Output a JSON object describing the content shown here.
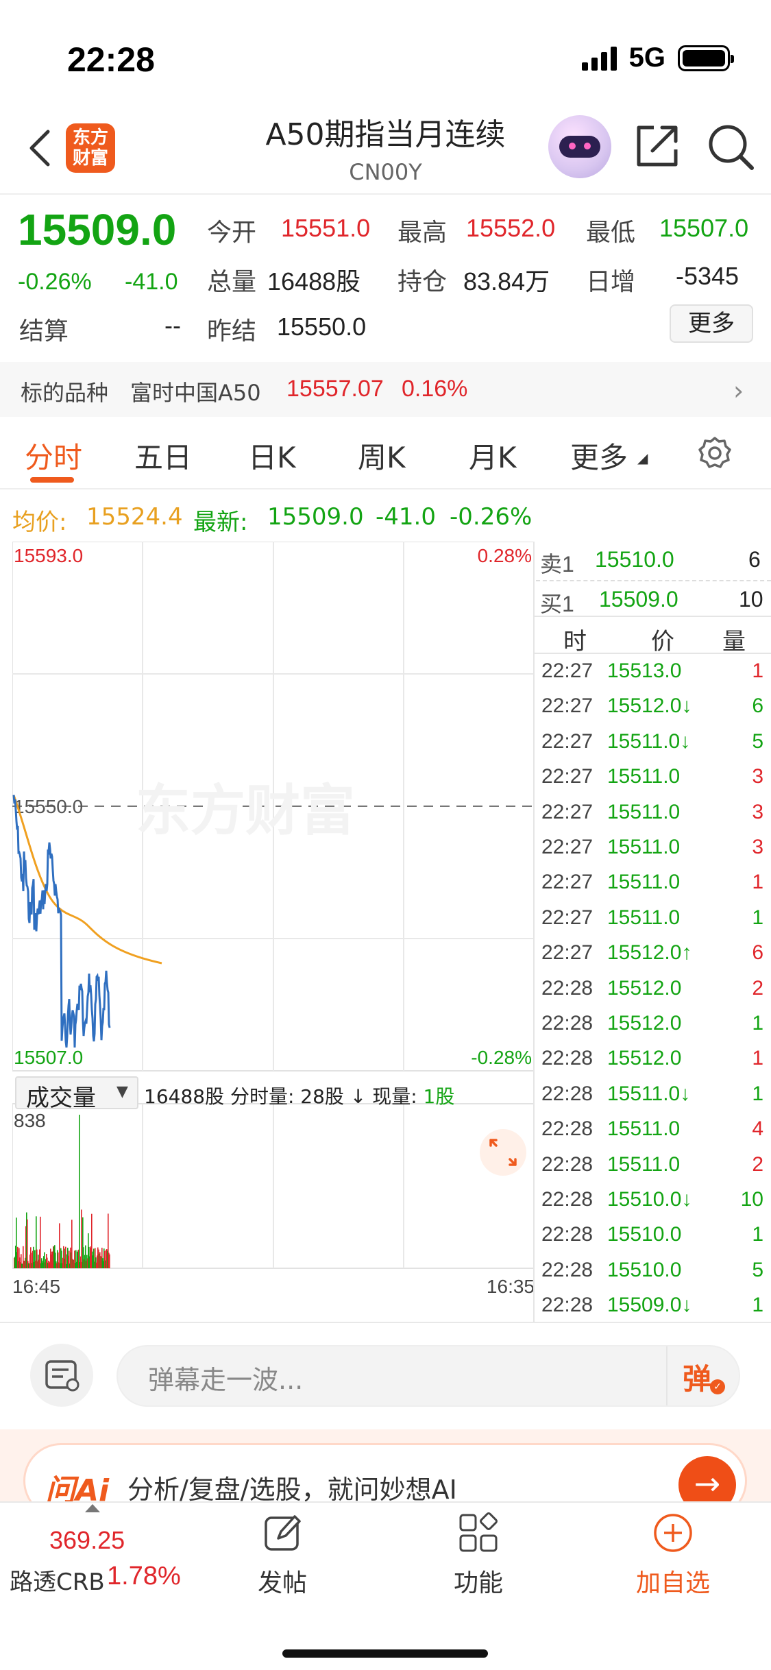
{
  "status": {
    "time": "22:28",
    "network": "5G"
  },
  "header": {
    "logo_line1": "东方",
    "logo_line2": "财富",
    "title": "A50期指当月连续",
    "code": "CN00Y"
  },
  "quote": {
    "last": "15509.0",
    "change_pct": "-0.26%",
    "change": "-41.0",
    "open_label": "今开",
    "open": "15551.0",
    "high_label": "最高",
    "high": "15552.0",
    "low_label": "最低",
    "low": "15507.0",
    "volume_label": "总量",
    "volume": "16488股",
    "oi_label": "持仓",
    "oi": "83.84万",
    "daily_inc_label": "日增",
    "daily_inc": "-5345",
    "settle_label": "结算",
    "settle": "--",
    "prev_settle_label": "昨结",
    "prev_settle": "15550.0",
    "more_label": "更多"
  },
  "underlying": {
    "label": "标的品种",
    "name": "富时中国A50",
    "price": "15557.07",
    "pct": "0.16%"
  },
  "tabs": [
    "分时",
    "五日",
    "日K",
    "周K",
    "月K",
    "更多"
  ],
  "avg_line": {
    "avg_label": "均价:",
    "avg": "15524.4",
    "latest_label": "最新:",
    "latest": "15509.0",
    "chg": "-41.0",
    "pct": "-0.26%"
  },
  "chart": {
    "y_max": "15593.0",
    "y_mid": "15550.0",
    "y_min": "15507.0",
    "pct_max": "0.28%",
    "pct_min": "-0.28%",
    "watermark": "东方财富",
    "x_start": "16:45",
    "x_end": "16:35",
    "vol_max": "838",
    "colors": {
      "price": "#2f6fc0",
      "avg": "#f0a020",
      "up": "#e0262b",
      "down": "#13a413"
    }
  },
  "volume_bar": {
    "dropdown": "成交量",
    "info": "16488股 分时量: 28股 ↓ 现量: ",
    "current": "1股"
  },
  "orderbook": {
    "ask_label": "卖1",
    "ask_price": "15510.0",
    "ask_qty": "6",
    "bid_label": "买1",
    "bid_price": "15509.0",
    "bid_qty": "10"
  },
  "trades_header": {
    "time": "时",
    "price": "价",
    "qty": "量"
  },
  "trades": [
    {
      "t": "22:27",
      "p": "15513.0",
      "v": "1",
      "pc": "green",
      "vc": "red"
    },
    {
      "t": "22:27",
      "p": "15512.0↓",
      "v": "6",
      "pc": "green",
      "vc": "green"
    },
    {
      "t": "22:27",
      "p": "15511.0↓",
      "v": "5",
      "pc": "green",
      "vc": "green"
    },
    {
      "t": "22:27",
      "p": "15511.0",
      "v": "3",
      "pc": "green",
      "vc": "red"
    },
    {
      "t": "22:27",
      "p": "15511.0",
      "v": "3",
      "pc": "green",
      "vc": "red"
    },
    {
      "t": "22:27",
      "p": "15511.0",
      "v": "3",
      "pc": "green",
      "vc": "red"
    },
    {
      "t": "22:27",
      "p": "15511.0",
      "v": "1",
      "pc": "green",
      "vc": "red"
    },
    {
      "t": "22:27",
      "p": "15511.0",
      "v": "1",
      "pc": "green",
      "vc": "green"
    },
    {
      "t": "22:27",
      "p": "15512.0↑",
      "v": "6",
      "pc": "green",
      "vc": "red"
    },
    {
      "t": "22:28",
      "p": "15512.0",
      "v": "2",
      "pc": "green",
      "vc": "red"
    },
    {
      "t": "22:28",
      "p": "15512.0",
      "v": "1",
      "pc": "green",
      "vc": "green"
    },
    {
      "t": "22:28",
      "p": "15512.0",
      "v": "1",
      "pc": "green",
      "vc": "red"
    },
    {
      "t": "22:28",
      "p": "15511.0↓",
      "v": "1",
      "pc": "green",
      "vc": "green"
    },
    {
      "t": "22:28",
      "p": "15511.0",
      "v": "4",
      "pc": "green",
      "vc": "red"
    },
    {
      "t": "22:28",
      "p": "15511.0",
      "v": "2",
      "pc": "green",
      "vc": "red"
    },
    {
      "t": "22:28",
      "p": "15510.0↓",
      "v": "10",
      "pc": "green",
      "vc": "green"
    },
    {
      "t": "22:28",
      "p": "15510.0",
      "v": "1",
      "pc": "green",
      "vc": "green"
    },
    {
      "t": "22:28",
      "p": "15510.0",
      "v": "5",
      "pc": "green",
      "vc": "green"
    },
    {
      "t": "22:28",
      "p": "15509.0↓",
      "v": "1",
      "pc": "green",
      "vc": "green"
    }
  ],
  "comment": {
    "placeholder": "弹幕走一波...",
    "danmu": "弹"
  },
  "ai_banner": {
    "logo": "问Ai",
    "text": "分析/复盘/选股，就问妙想AI"
  },
  "bottom": {
    "crb_price": "369.25",
    "crb_name": "路透CRB",
    "crb_pct": "1.78%",
    "post": "发帖",
    "func": "功能",
    "watch": "加自选"
  }
}
